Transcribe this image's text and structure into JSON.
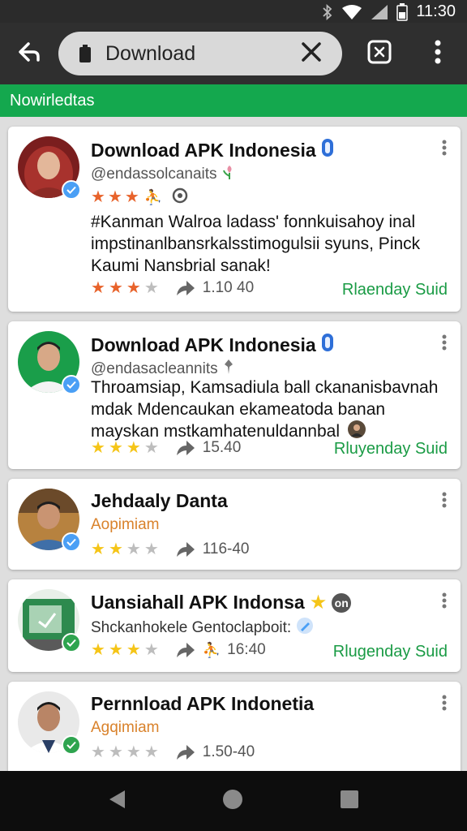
{
  "status": {
    "time": "11:30"
  },
  "address_bar": {
    "value": "Download"
  },
  "section": {
    "title": "Nowirledtas"
  },
  "colors": {
    "accent": "#14a84e",
    "link": "#1a9b45",
    "star_filled": "#f5c518",
    "star_rated_orange": "#e8632b",
    "star_empty": "#bdbdbd",
    "verified_blue": "#4a9ff5",
    "verified_green": "#2ea44f",
    "subtitle_orange": "#d9822b"
  },
  "cards": [
    {
      "title": "Download APK Indonesia",
      "subtitle": "@endassolcanaits",
      "body": "#Kanman Walroa ladass' fonnkuisahoy inal impstinanlbansrkalsstimogulsii syuns, Pinck Kaumi Nansbrial sanak!",
      "rating_stars": 2.5,
      "meta_value": "1.10 40",
      "action": "Rlaenday Suid"
    },
    {
      "title": "Download APK Indonesia",
      "subtitle": "@endasacleannits",
      "body": "Throamsiap, Kamsadiula ball ckananisbavnah mdak Mdencaukan ekameatoda banan mayskan mstkamhatenuldannbal",
      "rating_stars": 3,
      "meta_value": "15.40",
      "action": "Rluyenday Suid"
    },
    {
      "title": "Jehdaaly Danta",
      "subtitle": "Aopimiam",
      "rating_stars": 2,
      "meta_value": "116-40"
    },
    {
      "title": "Uansiahall APK Indonsa",
      "subtitle": "Shckanhokele Gentoclapboit:",
      "tag": "on",
      "rating_stars": 3,
      "meta_value": "16:40",
      "action": "Rlugenday Suid"
    },
    {
      "title": "Pernnload APK Indonetia",
      "subtitle": "Agqimiam",
      "rating_stars": 0,
      "meta_value": "1.50-40"
    }
  ]
}
